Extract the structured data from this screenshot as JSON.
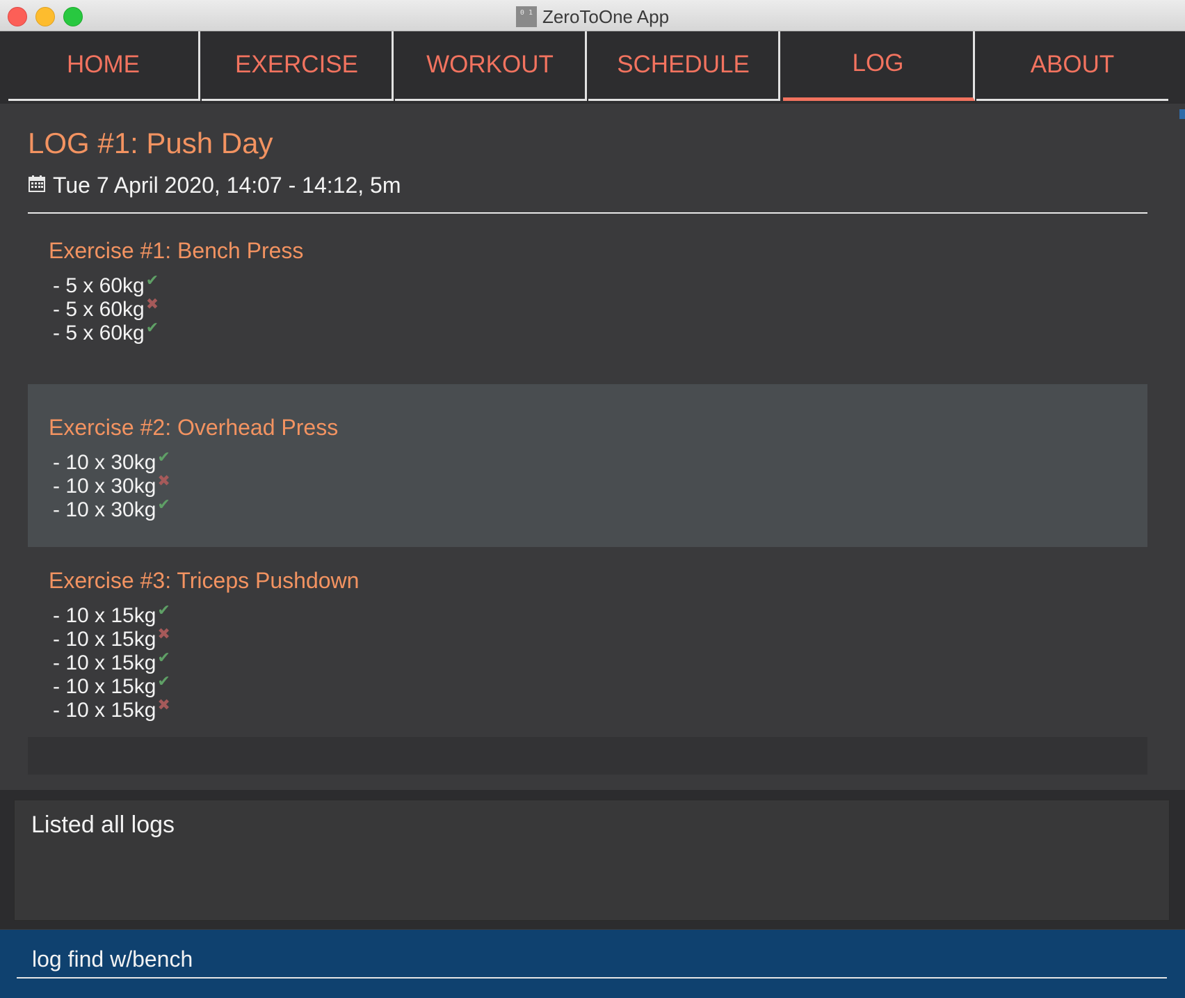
{
  "window": {
    "title": "ZeroToOne App",
    "icon_text": "0 1"
  },
  "tabs": [
    {
      "label": "HOME"
    },
    {
      "label": "EXERCISE"
    },
    {
      "label": "WORKOUT"
    },
    {
      "label": "SCHEDULE"
    },
    {
      "label": "LOG",
      "active": true
    },
    {
      "label": "ABOUT"
    }
  ],
  "log": {
    "title": "LOG #1: Push Day",
    "date": "Tue 7 April 2020,  14:07 - 14:12, 5m",
    "exercises": [
      {
        "title": "Exercise #1: Bench Press",
        "sets": [
          {
            "text": "- 5 x 60kg",
            "done": true
          },
          {
            "text": "- 5 x 60kg",
            "done": false
          },
          {
            "text": "- 5 x 60kg",
            "done": true
          }
        ]
      },
      {
        "title": "Exercise #2: Overhead Press",
        "sets": [
          {
            "text": "- 10 x 30kg",
            "done": true
          },
          {
            "text": "- 10 x 30kg",
            "done": false
          },
          {
            "text": "- 10 x 30kg",
            "done": true
          }
        ]
      },
      {
        "title": "Exercise #3: Triceps Pushdown",
        "sets": [
          {
            "text": "- 10 x 15kg",
            "done": true
          },
          {
            "text": "- 10 x 15kg",
            "done": false
          },
          {
            "text": "- 10 x 15kg",
            "done": true
          },
          {
            "text": "- 10 x 15kg",
            "done": true
          },
          {
            "text": "- 10 x 15kg",
            "done": false
          }
        ]
      }
    ]
  },
  "result": {
    "text": "Listed all logs"
  },
  "command": {
    "value": "log find w/bench"
  },
  "icons": {
    "calendar": "calendar-icon",
    "done": "check-icon",
    "failed": "cross-icon"
  },
  "colors": {
    "accent": "#f2735f",
    "heading": "#f39361",
    "success": "#5fa066",
    "failure": "#a65a5a",
    "command_bg": "#0f416f"
  }
}
